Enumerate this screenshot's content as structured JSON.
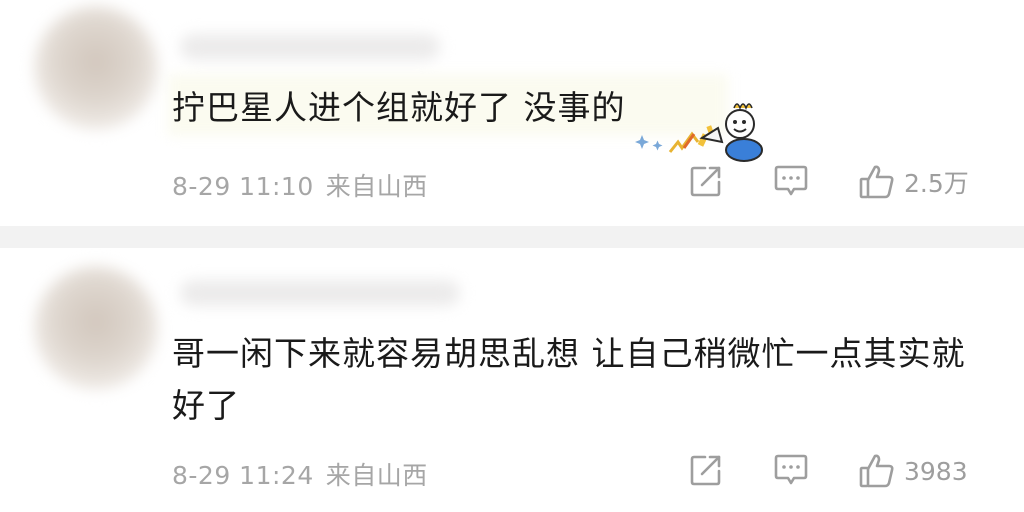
{
  "comments": [
    {
      "text": "拧巴星人进个组就好了 没事的",
      "date": "8-29 11:10",
      "location": "来自山西",
      "likes": "2.5万",
      "sticker": "celebration-sticker"
    },
    {
      "text": "哥一闲下来就容易胡思乱想 让自己稍微忙一点其实就好了",
      "date": "8-29 11:24",
      "location": "来自山西",
      "likes": "3983"
    }
  ],
  "icons": {
    "share": "share-icon",
    "reply": "reply-icon",
    "like": "thumbs-up-icon"
  },
  "colors": {
    "meta_text": "#a6a6a6",
    "icon": "#9e9e9e",
    "divider": "#f2f2f2"
  }
}
